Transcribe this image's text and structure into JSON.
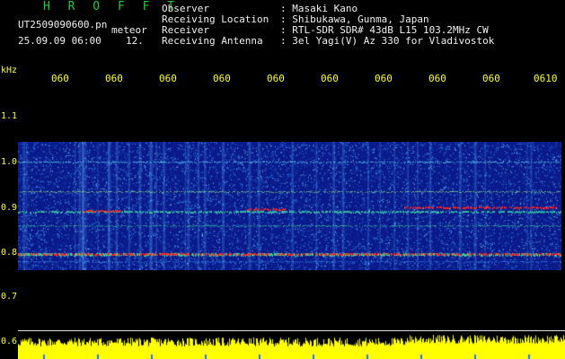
{
  "header": {
    "app_title": "H R O F F T",
    "file_name": "UT2509090600.pn",
    "meteor_label": "meteor",
    "date_time": "25.09.09 06:00",
    "count": "12.",
    "info": [
      {
        "label": "Observer",
        "value": ": Masaki Kano"
      },
      {
        "label": "Receiving Location",
        "value": ": Shibukawa, Gunma, Japan"
      },
      {
        "label": "Receiver",
        "value": ": RTL-SDR SDR# 43dB L15 103.2MHz CW"
      },
      {
        "label": "Receiving Antenna",
        "value": ": 3el Yagi(V) Az 330 for Vladivostok"
      }
    ]
  },
  "axis": {
    "unit": "kHz",
    "y_ticks": [
      "1.1",
      "1.0",
      "0.9",
      "0.8",
      "0.7",
      "0.6"
    ],
    "x_ticks": [
      "060",
      "060",
      "060",
      "060",
      "060",
      "060",
      "060",
      "060",
      "060",
      "0610"
    ]
  },
  "colors": {
    "background": "#000000",
    "title": "#22c93a",
    "axis_text": "#ffff22",
    "spectrum_base": "#0a1a8a",
    "spectrum_noise": "#3aa0ff",
    "echo_line": "#ff2020",
    "meter": "#ffff00"
  }
}
